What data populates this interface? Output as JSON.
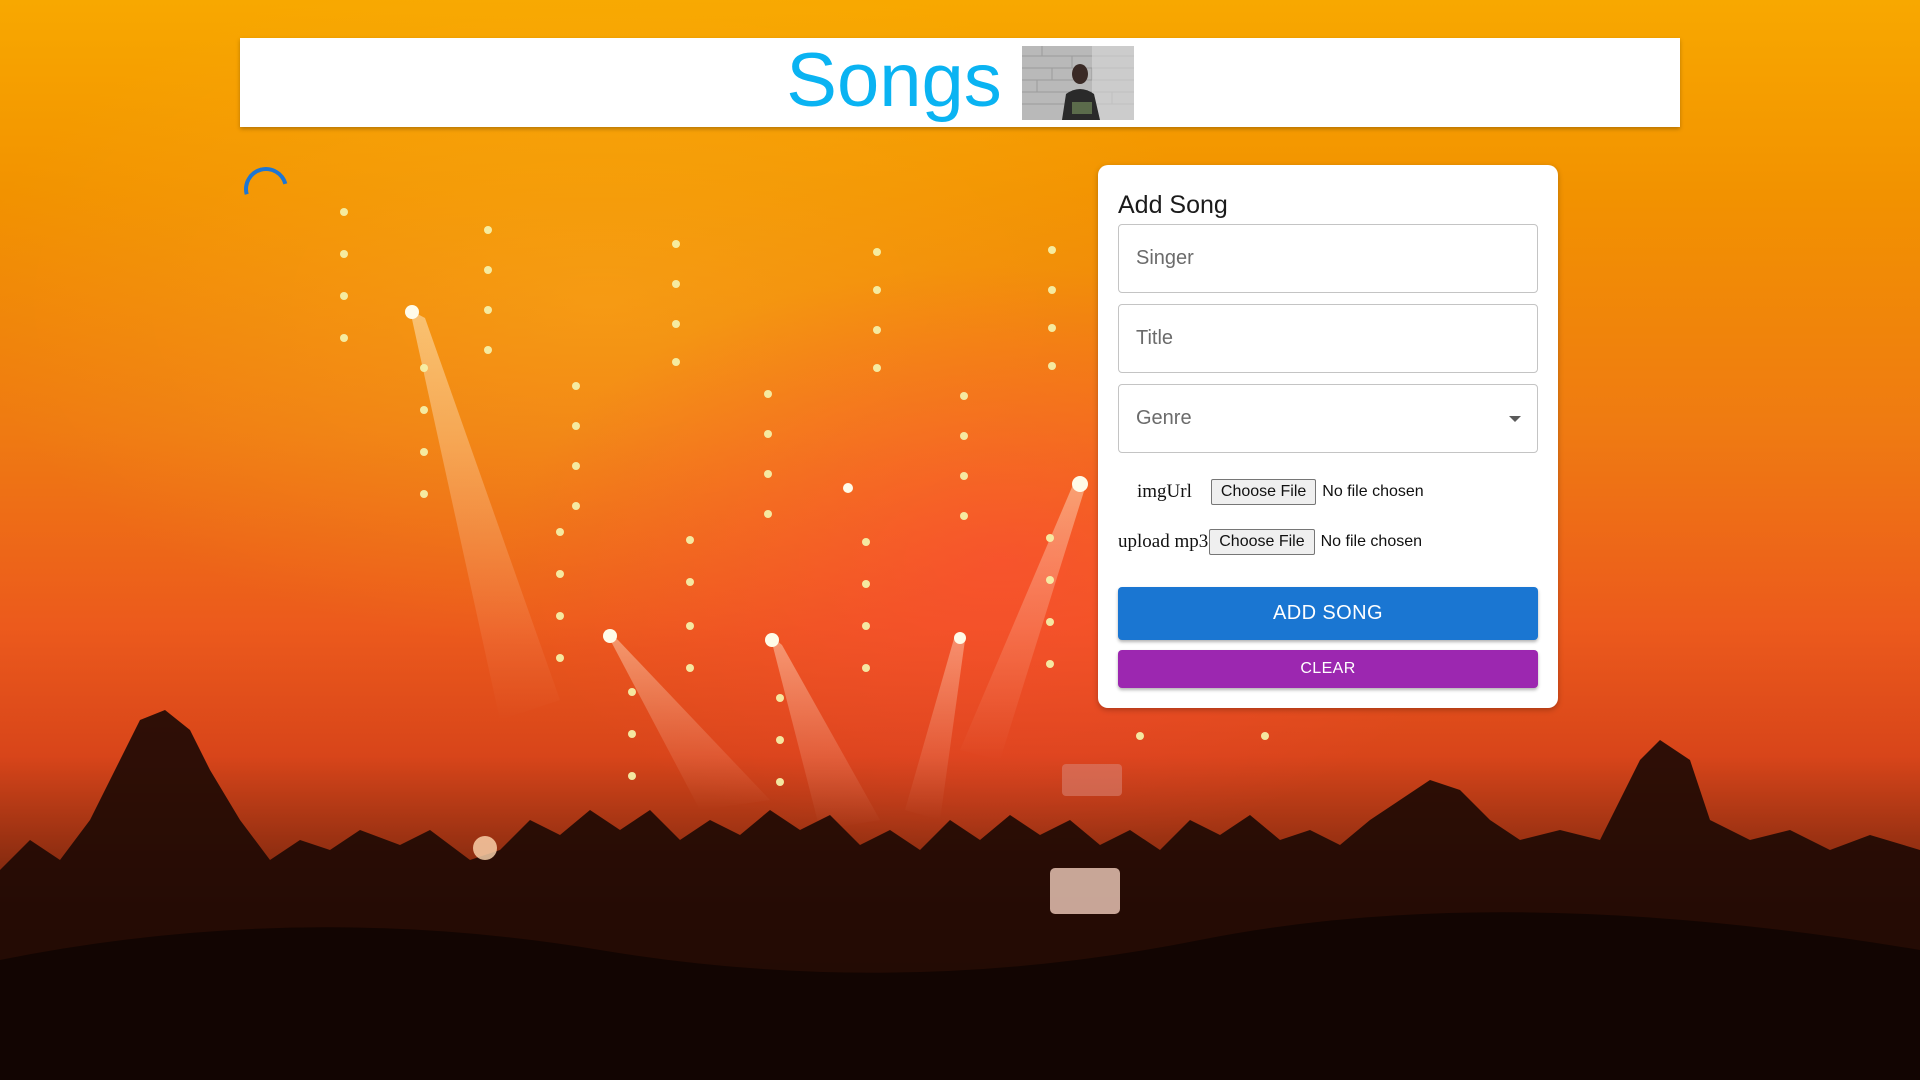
{
  "header": {
    "title": "Songs",
    "thumbnail_icon": "singer-photo-thumbnail"
  },
  "status": {
    "loading": true
  },
  "add_song_form": {
    "title": "Add Song",
    "singer_placeholder": "Singer",
    "title_placeholder": "Title",
    "genre_label": "Genre",
    "img_url_label": "imgUrl",
    "img_url_button": "Choose File",
    "img_url_status": "No file chosen",
    "mp3_label": "upload mp3",
    "mp3_button": "Choose File",
    "mp3_status": "No file chosen",
    "add_button": "ADD SONG",
    "clear_button": "CLEAR"
  },
  "colors": {
    "title_color": "#0ab3f2",
    "primary": "#1a76d2",
    "secondary": "#9c27b0"
  }
}
